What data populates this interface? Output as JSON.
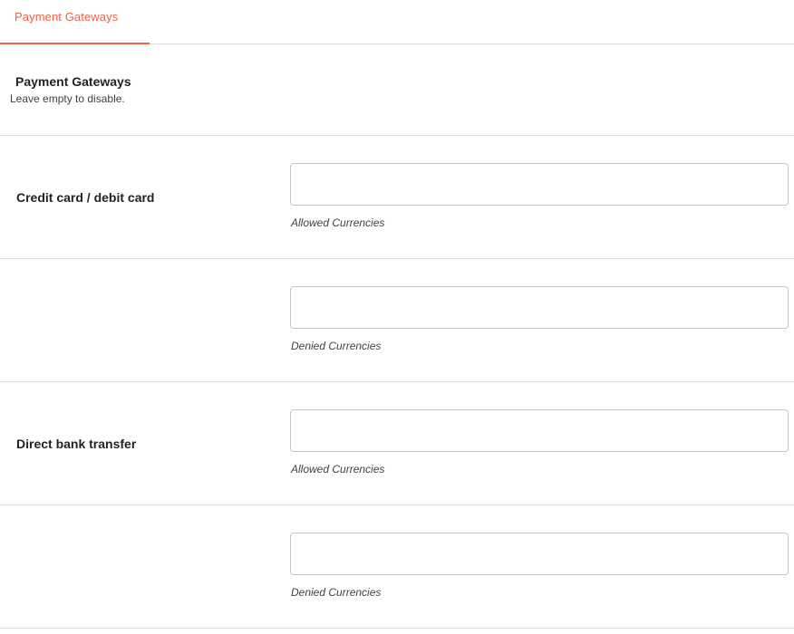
{
  "tabs": [
    {
      "label": "Payment Gateways",
      "active": true
    }
  ],
  "section": {
    "title": "Payment Gateways",
    "description": "Leave empty to disable."
  },
  "rows": [
    {
      "label": "Credit card / debit card",
      "value": "",
      "description": "Allowed Currencies"
    },
    {
      "label": "",
      "value": "",
      "description": "Denied Currencies"
    },
    {
      "label": "Direct bank transfer",
      "value": "",
      "description": "Allowed Currencies"
    },
    {
      "label": "",
      "value": "",
      "description": "Denied Currencies"
    }
  ],
  "colors": {
    "accent": "#f0604a",
    "border": "#dcdcde",
    "input_border": "#c3c4c7",
    "text": "#1d2327"
  }
}
